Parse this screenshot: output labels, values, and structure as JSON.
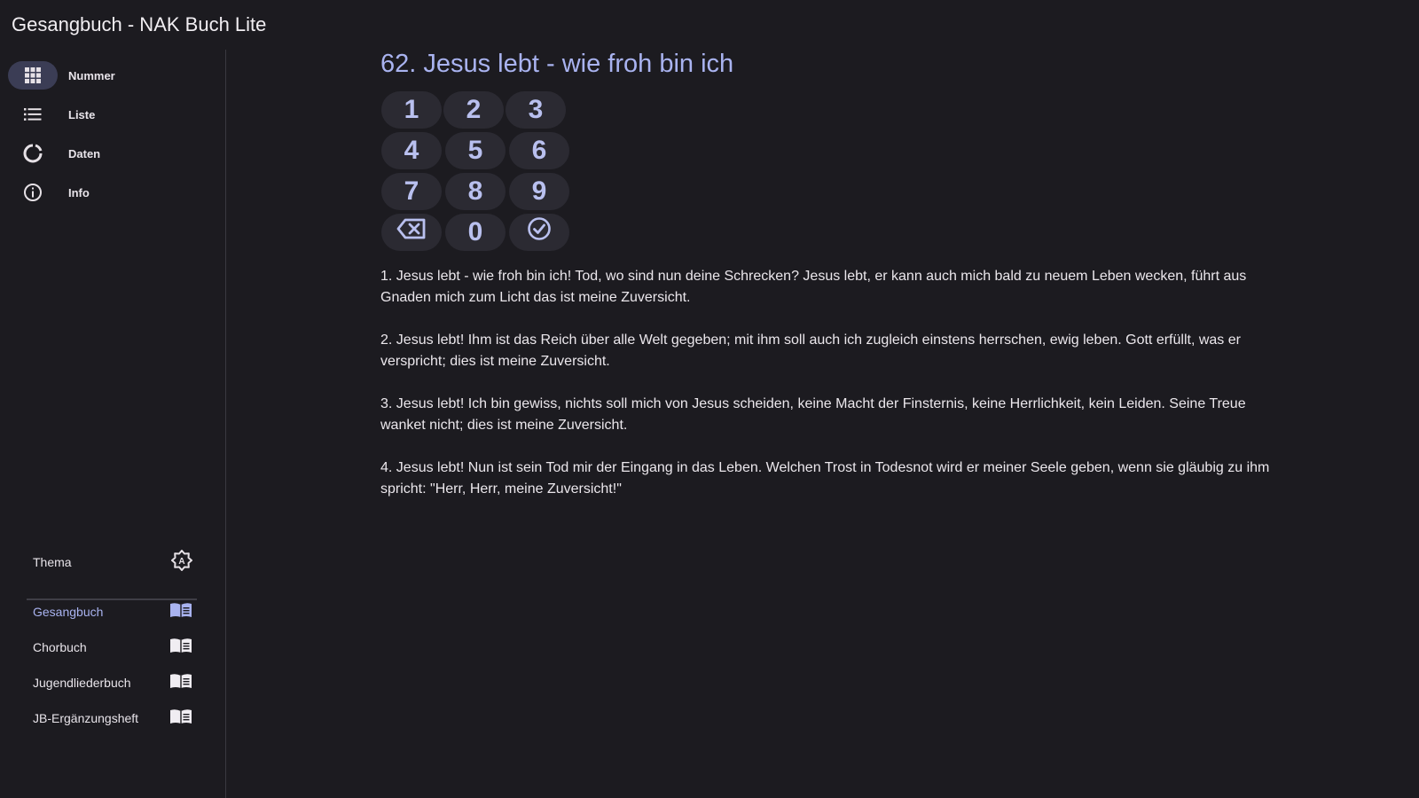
{
  "app": {
    "title": "Gesangbuch - NAK Buch Lite"
  },
  "nav": [
    {
      "label": "Nummer",
      "icon": "grid-icon",
      "active": true
    },
    {
      "label": "Liste",
      "icon": "list-icon",
      "active": false
    },
    {
      "label": "Daten",
      "icon": "refresh-icon",
      "active": false
    },
    {
      "label": "Info",
      "icon": "info-icon",
      "active": false
    }
  ],
  "theme": {
    "label": "Thema",
    "icon": "brightness-auto-icon"
  },
  "books": [
    {
      "label": "Gesangbuch",
      "icon": "book-open-icon",
      "active": true
    },
    {
      "label": "Chorbuch",
      "icon": "book-open-icon",
      "active": false
    },
    {
      "label": "Jugendliederbuch",
      "icon": "book-open-icon",
      "active": false
    },
    {
      "label": "JB-Ergänzungsheft",
      "icon": "book-open-icon",
      "active": false
    }
  ],
  "song": {
    "title": "62. Jesus lebt - wie froh bin ich",
    "verses": [
      "1. Jesus lebt - wie froh bin ich! Tod, wo sind nun deine Schrecken? Jesus lebt, er kann auch mich bald zu neuem Leben wecken, führt aus Gnaden mich zum Licht  das ist meine Zuversicht.",
      "2. Jesus lebt! Ihm ist das Reich über alle Welt gegeben; mit ihm soll auch ich zugleich einstens herrschen, ewig leben. Gott erfüllt, was er verspricht; dies ist meine Zuversicht.",
      "3. Jesus lebt! Ich bin gewiss, nichts soll mich von Jesus scheiden, keine Macht der Finsternis, keine Herrlichkeit, kein Leiden. Seine Treue wanket nicht; dies ist meine Zuversicht.",
      "4. Jesus lebt! Nun ist sein Tod mir der Eingang in das Leben. Welchen Trost in Todesnot wird er meiner Seele geben, wenn sie gläubig zu ihm spricht: \"Herr, Herr, meine Zuversicht!\""
    ]
  },
  "keypad": {
    "keys": [
      "1",
      "2",
      "3",
      "4",
      "5",
      "6",
      "7",
      "8",
      "9"
    ],
    "zero": "0",
    "backspace_icon": "backspace-icon",
    "confirm_icon": "check-circle-icon"
  },
  "colors": {
    "background": "#1c1b20",
    "accent": "#a9b3f0",
    "key_background": "#2b2a32",
    "active_pill": "#3b3d55"
  }
}
